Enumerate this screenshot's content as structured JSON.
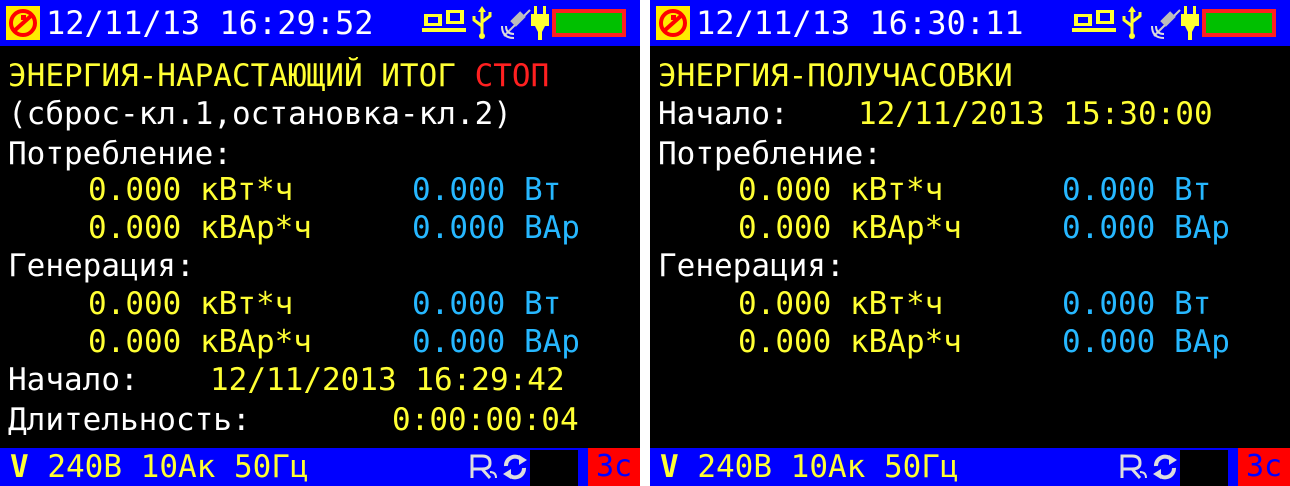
{
  "left": {
    "status": {
      "datetime": "12/11/13 16:29:52"
    },
    "title": "ЭНЕРГИЯ-НАРАСТАЮЩИЙ ИТОГ",
    "title_status": "СТОП",
    "hint": "(сброс-кл.1,остановка-кл.2)",
    "consumption_label": "Потребление:",
    "consumption": {
      "active_energy": "0.000 кВт*ч",
      "active_power": "0.000 Вт",
      "reactive_energy": "0.000 кВАр*ч",
      "reactive_power": "0.000 ВАр"
    },
    "generation_label": "Генерация:",
    "generation": {
      "active_energy": "0.000 кВт*ч",
      "active_power": "0.000 Вт",
      "reactive_energy": "0.000 кВАр*ч",
      "reactive_power": "0.000 ВАр"
    },
    "start_label": "Начало:",
    "start_value": "12/11/2013 16:29:42",
    "duration_label": "Длительность:",
    "duration_value": "0:00:00:04",
    "bottom": {
      "nominal": "240В 10Ак 50Гц",
      "interval": "3с"
    }
  },
  "right": {
    "status": {
      "datetime": "12/11/13 16:30:11"
    },
    "title": "ЭНЕРГИЯ-ПОЛУЧАСОВКИ",
    "start_label": "Начало:",
    "start_value": "12/11/2013 15:30:00",
    "consumption_label": "Потребление:",
    "consumption": {
      "active_energy": "0.000 кВт*ч",
      "active_power": "0.000 Вт",
      "reactive_energy": "0.000 кВАр*ч",
      "reactive_power": "0.000 ВАр"
    },
    "generation_label": "Генерация:",
    "generation": {
      "active_energy": "0.000 кВт*ч",
      "active_power": "0.000 Вт",
      "reactive_energy": "0.000 кВАр*ч",
      "reactive_power": "0.000 ВАр"
    },
    "bottom": {
      "nominal": "240В 10Ак 50Гц",
      "interval": "3с"
    }
  },
  "icons": [
    "brand-logo-icon",
    "pc-link-icon",
    "usb-icon",
    "gps-icon",
    "power-plug-icon",
    "battery-icon",
    "voltage-icon",
    "remote-icon",
    "cycle-icon"
  ],
  "colors": {
    "background": "#000000",
    "bar": "#0000ff",
    "label": "#ffffff",
    "value": "#ffff33",
    "power": "#26b7ff",
    "alert": "#ff2020",
    "battery": "#00c000"
  }
}
